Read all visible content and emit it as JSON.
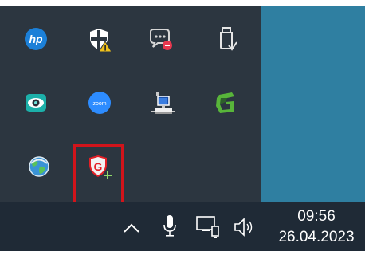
{
  "tray_overflow": {
    "icons": [
      {
        "name": "hp-icon",
        "label": "hp"
      },
      {
        "name": "windows-security-warning-icon"
      },
      {
        "name": "chat-notification-icon"
      },
      {
        "name": "usb-safely-remove-icon"
      },
      {
        "name": "eye-monitor-icon"
      },
      {
        "name": "zoom-icon",
        "label": "zoom"
      },
      {
        "name": "network-computer-icon"
      },
      {
        "name": "green-g-app-icon"
      },
      {
        "name": "globe-icon"
      },
      {
        "name": "g-data-shield-icon",
        "label": "G"
      }
    ]
  },
  "taskbar": {
    "show_hidden_icons_glyph": "^",
    "clock": {
      "time": "09:56",
      "date": "26.04.2023"
    }
  },
  "colors": {
    "flyout_bg": "#2c3640",
    "taskbar_bg": "#1f2a36",
    "desktop_bg": "#2f7fa1",
    "highlight": "#d2141b"
  }
}
